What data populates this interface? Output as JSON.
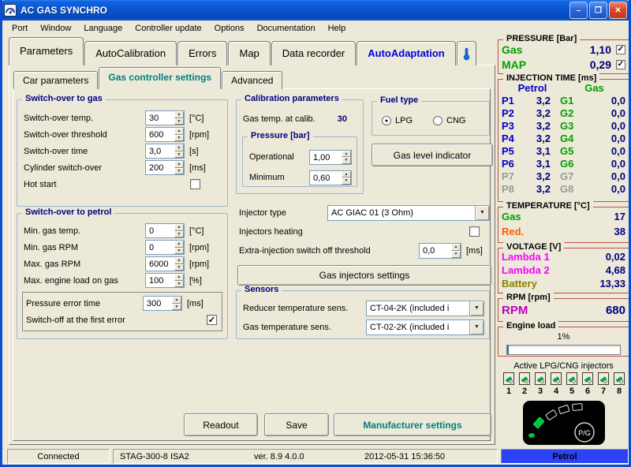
{
  "colors": {
    "gas_green": "#00a000",
    "petrol_navy": "#0000c8",
    "value_navy": "#000080",
    "reducer_orange": "#ff5a00",
    "lambda_magenta": "#ff00ff",
    "battery_olive": "#8b8000",
    "rpm_magenta": "#c000c0",
    "section_border_red": "#b9524a",
    "accent_teal": "#008080",
    "autoadaptation_blue": "#0000e0",
    "petrol_status_bg": "#2b43f5"
  },
  "window": {
    "title": "AC GAS SYNCHRO",
    "minimize": "–",
    "maximize": "❐",
    "close": "✕"
  },
  "menubar": {
    "items": [
      "Port",
      "Window",
      "Language",
      "Controller update",
      "Options",
      "Documentation",
      "Help"
    ]
  },
  "main_tabs": [
    "Parameters",
    "AutoCalibration",
    "Errors",
    "Map",
    "Data recorder",
    "AutoAdaptation"
  ],
  "sub_tabs": [
    "Car parameters",
    "Gas controller settings",
    "Advanced"
  ],
  "switch_to_gas": {
    "title": "Switch-over to gas",
    "rows": [
      {
        "label": "Switch-over temp.",
        "value": "30",
        "unit": "[°C]"
      },
      {
        "label": "Switch-over threshold",
        "value": "600",
        "unit": "[rpm]"
      },
      {
        "label": "Switch-over time",
        "value": "3,0",
        "unit": "[s]"
      },
      {
        "label": "Cylinder switch-over",
        "value": "200",
        "unit": "[ms]"
      }
    ],
    "hot_start": "Hot start"
  },
  "switch_to_petrol": {
    "title": "Switch-over to petrol",
    "rows": [
      {
        "label": "Min. gas temp.",
        "value": "0",
        "unit": "[°C]"
      },
      {
        "label": "Min. gas RPM",
        "value": "0",
        "unit": "[rpm]"
      },
      {
        "label": "Max. gas RPM",
        "value": "6000",
        "unit": "[rpm]"
      },
      {
        "label": "Max. engine load on gas",
        "value": "100",
        "unit": "[%]"
      }
    ],
    "pressure_error": {
      "label": "Pressure error time",
      "value": "300",
      "unit": "[ms]"
    },
    "switch_off": "Switch-off at the first error"
  },
  "calibration": {
    "title": "Calibration parameters",
    "gas_temp_label": "Gas temp. at calib.",
    "gas_temp_value": "30",
    "pressure": {
      "title": "Pressure [bar]",
      "rows": [
        {
          "label": "Operational",
          "value": "1,00"
        },
        {
          "label": "Minimum",
          "value": "0,60"
        }
      ]
    }
  },
  "fuel_type": {
    "title": "Fuel type",
    "lpg": "LPG",
    "cng": "CNG",
    "lpg_dot": "●",
    "cng_dot": ""
  },
  "injector": {
    "type_label": "Injector type",
    "type_value": "AC GIAC 01 (3 Ohm)",
    "heating_label": "Injectors heating",
    "extra_label": "Extra-injection switch off threshold",
    "extra_value": "0,0",
    "extra_unit": "[ms]"
  },
  "sensors": {
    "title": "Sensors",
    "rows": [
      {
        "label": "Reducer temperature sens.",
        "value": "CT-04-2K (included i"
      },
      {
        "label": "Gas temperature sens.",
        "value": "CT-02-2K (included i"
      }
    ]
  },
  "buttons": {
    "gas_level": "Gas level indicator",
    "gas_injectors": "Gas injectors settings",
    "readout": "Readout",
    "save": "Save",
    "manufacturer": "Manufacturer settings"
  },
  "checks": {
    "hot_start": "",
    "switch_off_first_error": "✓",
    "injectors_heating": "",
    "pressure_gas": "✓",
    "pressure_map": "✓"
  },
  "right_panel": {
    "pressure": {
      "title": "PRESSURE [Bar]",
      "rows": [
        {
          "label": "Gas",
          "value": "1,10"
        },
        {
          "label": "MAP",
          "value": "0,29"
        }
      ]
    },
    "injection": {
      "title": "INJECTION TIME [ms]",
      "petrol_header": "Petrol",
      "gas_header": "Gas",
      "rows": [
        {
          "p": "P1",
          "pv": "3,2",
          "g": "G1",
          "gv": "0,0"
        },
        {
          "p": "P2",
          "pv": "3,2",
          "g": "G2",
          "gv": "0,0"
        },
        {
          "p": "P3",
          "pv": "3,2",
          "g": "G3",
          "gv": "0,0"
        },
        {
          "p": "P4",
          "pv": "3,2",
          "g": "G4",
          "gv": "0,0"
        },
        {
          "p": "P5",
          "pv": "3,1",
          "g": "G5",
          "gv": "0,0"
        },
        {
          "p": "P6",
          "pv": "3,1",
          "g": "G6",
          "gv": "0,0"
        },
        {
          "p": "P7",
          "pv": "3,2",
          "g": "G7",
          "gv": "0,0"
        },
        {
          "p": "P8",
          "pv": "3,2",
          "g": "G8",
          "gv": "0,0"
        }
      ]
    },
    "temperature": {
      "title": "TEMPERATURE [°C]",
      "rows": [
        {
          "label": "Gas",
          "value": "17"
        },
        {
          "label": "Red.",
          "value": "38"
        }
      ]
    },
    "voltage": {
      "title": "VOLTAGE [V]",
      "rows": [
        {
          "label": "Lambda 1",
          "value": "0,02"
        },
        {
          "label": "Lambda 2",
          "value": "4,68"
        },
        {
          "label": "Battery",
          "value": "13,33"
        }
      ]
    },
    "rpm": {
      "title": "RPM [rpm]",
      "label": "RPM",
      "value": "680"
    },
    "engine_load": {
      "title": "Engine load",
      "value": "1%"
    },
    "active_injectors_label": "Active LPG/CNG injectors",
    "injector_numbers": [
      "1",
      "2",
      "3",
      "4",
      "5",
      "6",
      "7",
      "8"
    ],
    "pg_label": "P/G"
  },
  "statusbar": {
    "connection": "Connected",
    "device": "STAG-300-8 ISA2",
    "version": "ver. 8.9 4.0.0",
    "datetime": "2012-05-31 15:36:50",
    "fuel": "Petrol"
  }
}
